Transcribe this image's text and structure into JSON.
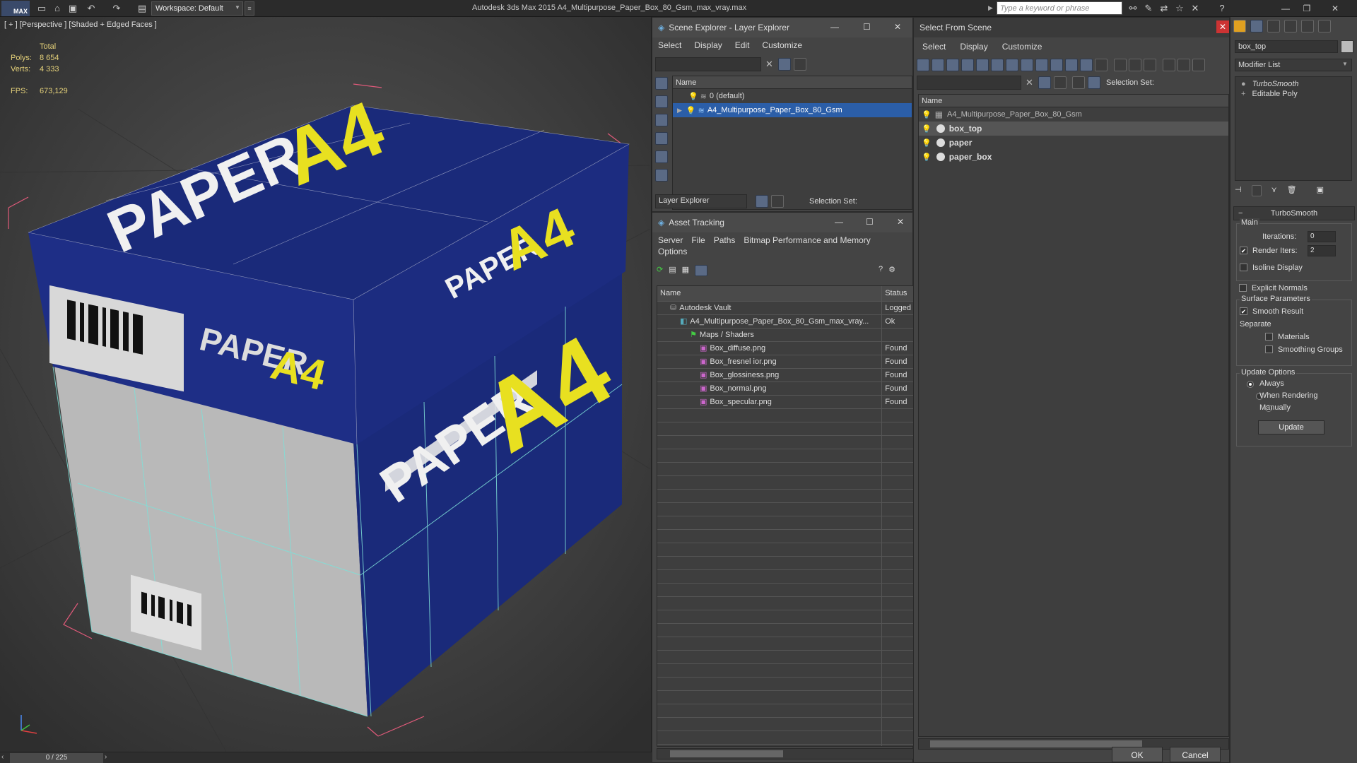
{
  "app": {
    "logo": "MAX",
    "title": "Autodesk 3ds Max  2015    A4_Multipurpose_Paper_Box_80_Gsm_max_vray.max",
    "workspace": "Workspace: Default",
    "search_placeholder": "Type a keyword or phrase"
  },
  "viewport": {
    "label": "[ + ] [Perspective ] [Shaded + Edged Faces ]",
    "stats": {
      "total_label": "Total",
      "polys_label": "Polys:",
      "polys_value": "8 654",
      "verts_label": "Verts:",
      "verts_value": "4 333",
      "fps_label": "FPS:",
      "fps_value": "673,129"
    },
    "texture_text": {
      "paper": "PAPER",
      "a4": "A4"
    }
  },
  "timeline": {
    "frame": "0 / 225"
  },
  "scene_explorer": {
    "title": "Scene Explorer - Layer Explorer",
    "menu": [
      "Select",
      "Display",
      "Edit",
      "Customize"
    ],
    "column_name": "Name",
    "rows": [
      {
        "label": "0 (default)",
        "selected": false
      },
      {
        "label": "A4_Multipurpose_Paper_Box_80_Gsm",
        "selected": true
      }
    ],
    "footer_dropdown": "Layer Explorer",
    "selection_set_label": "Selection Set:"
  },
  "asset_tracking": {
    "title": "Asset Tracking",
    "menu": [
      "Server",
      "File",
      "Paths",
      "Bitmap Performance and Memory"
    ],
    "menu2": [
      "Options"
    ],
    "col_name": "Name",
    "col_status": "Status",
    "rows": [
      {
        "name": "Autodesk Vault",
        "status": "Logged",
        "indent": 1,
        "icon": "vault-icon"
      },
      {
        "name": "A4_Multipurpose_Paper_Box_80_Gsm_max_vray...",
        "status": "Ok",
        "indent": 2,
        "icon": "max-file-icon"
      },
      {
        "name": "Maps / Shaders",
        "status": "",
        "indent": 3,
        "icon": "maps-icon"
      },
      {
        "name": "Box_diffuse.png",
        "status": "Found",
        "indent": 4,
        "icon": "png-icon"
      },
      {
        "name": "Box_fresnel ior.png",
        "status": "Found",
        "indent": 4,
        "icon": "png-icon"
      },
      {
        "name": "Box_glossiness.png",
        "status": "Found",
        "indent": 4,
        "icon": "png-icon"
      },
      {
        "name": "Box_normal.png",
        "status": "Found",
        "indent": 4,
        "icon": "png-icon"
      },
      {
        "name": "Box_specular.png",
        "status": "Found",
        "indent": 4,
        "icon": "png-icon"
      }
    ]
  },
  "select_from_scene": {
    "title": "Select From Scene",
    "menu": [
      "Select",
      "Display",
      "Customize"
    ],
    "selection_set_label": "Selection Set:",
    "column_name": "Name",
    "rows": [
      {
        "label": "A4_Multipurpose_Paper_Box_80_Gsm",
        "type": "group",
        "selected": false
      },
      {
        "label": "box_top",
        "type": "object",
        "selected": true
      },
      {
        "label": "paper",
        "type": "object",
        "selected": false
      },
      {
        "label": "paper_box",
        "type": "object",
        "selected": false
      }
    ],
    "ok": "OK",
    "cancel": "Cancel"
  },
  "command_panel": {
    "object_name": "box_top",
    "modifier_list": "Modifier List",
    "stack": [
      "TurboSmooth",
      "Editable Poly"
    ],
    "rollout_title": "TurboSmooth",
    "main_label": "Main",
    "iterations_label": "Iterations:",
    "iterations_value": "0",
    "render_iters_label": "Render Iters:",
    "render_iters_value": "2",
    "render_iters_checked": true,
    "isoline_label": "Isoline Display",
    "explicit_normals_label": "Explicit Normals",
    "surface_params_label": "Surface Parameters",
    "smooth_result_label": "Smooth Result",
    "separate_label": "Separate",
    "materials_label": "Materials",
    "smoothing_groups_label": "Smoothing Groups",
    "update_options_label": "Update Options",
    "always_label": "Always",
    "when_rendering_label": "When Rendering",
    "manually_label": "Manually",
    "update_button": "Update",
    "update_option_selected": "Always"
  },
  "colors": {
    "box_blue": "#1a2a7a",
    "accent_yellow": "#e8e020",
    "selection_blue": "#2b5ea8",
    "wire_cyan": "#7fe0d8",
    "bbox_pink": "#e05a7a"
  }
}
